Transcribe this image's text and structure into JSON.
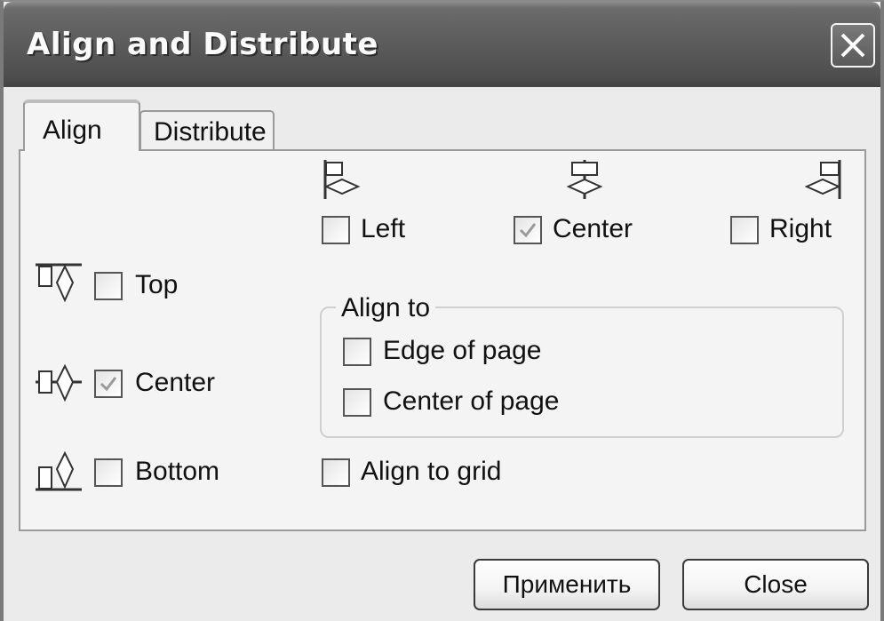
{
  "window": {
    "title": "Align and Distribute"
  },
  "tabs": [
    {
      "label": "Align",
      "active": true
    },
    {
      "label": "Distribute",
      "active": false
    }
  ],
  "horizontal": {
    "left": {
      "label": "Left",
      "checked": false
    },
    "center": {
      "label": "Center",
      "checked": true
    },
    "right": {
      "label": "Right",
      "checked": false
    }
  },
  "vertical": {
    "top": {
      "label": "Top",
      "checked": false
    },
    "center": {
      "label": "Center",
      "checked": true
    },
    "bottom": {
      "label": "Bottom",
      "checked": false
    }
  },
  "align_to": {
    "legend": "Align to",
    "edge_of_page": {
      "label": "Edge of page",
      "checked": false
    },
    "center_of_page": {
      "label": "Center of page",
      "checked": false
    }
  },
  "align_to_grid": {
    "label": "Align to grid",
    "checked": false
  },
  "buttons": {
    "apply": "Применить",
    "close": "Close"
  },
  "colors": {
    "titlebar": "#5d5d5d",
    "dialog_bg": "#ebebeb",
    "panel_bg": "#f4f4f4",
    "check_disabled": "#9a9a9a"
  },
  "icons": [
    "close-icon",
    "align-left-icon",
    "align-center-horizontal-icon",
    "align-right-icon",
    "align-top-icon",
    "align-center-vertical-icon",
    "align-bottom-icon",
    "checkmark-icon"
  ]
}
